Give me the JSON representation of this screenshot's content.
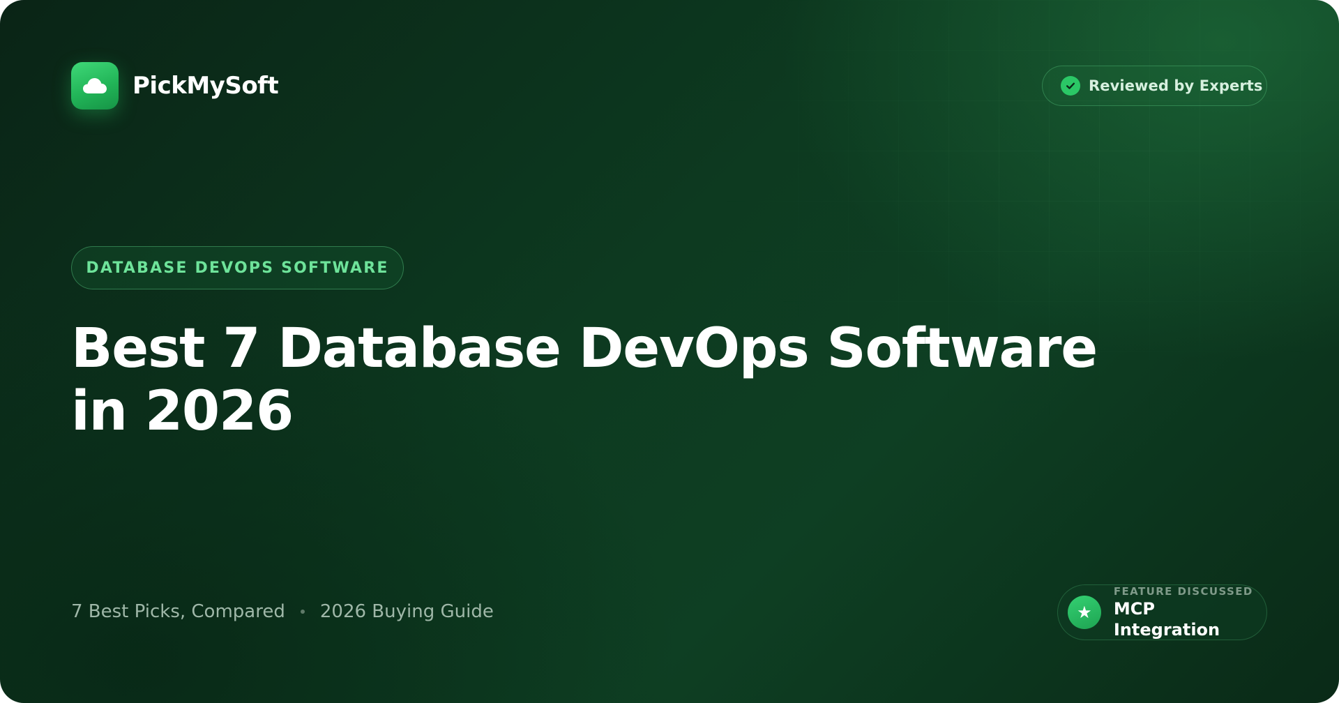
{
  "brand": {
    "name": "PickMySoft",
    "logo_icon": "cloud-icon",
    "accent_color": "#2bc766"
  },
  "reviewed_badge": {
    "label": "Reviewed by Experts",
    "icon": "check-circle-icon"
  },
  "category": {
    "label": "DATABASE DEVOPS SOFTWARE"
  },
  "headline": {
    "line1": "Best 7 Database DevOps Software",
    "line2": "in 2026"
  },
  "meta": {
    "item1": "7 Best Picks, Compared",
    "item2": "2026 Buying Guide"
  },
  "feature_badge": {
    "kicker": "FEATURE DISCUSSED",
    "title": "MCP Integration",
    "icon": "star-icon"
  }
}
